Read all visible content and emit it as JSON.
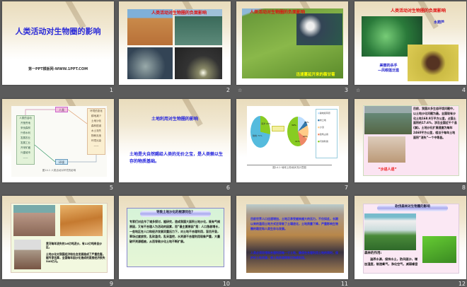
{
  "slides": [
    {
      "number": "1",
      "title": "人类活动对生物圈的影响",
      "footer": "第一PPT模板网-WWW.1PPT.COM"
    },
    {
      "number": "2",
      "title": "人类活动对生物圈的负面影响"
    },
    {
      "number": "3",
      "title": "人类活动对生物圈的负面影响",
      "caption": "迅速蔓延开来的薇甘菊",
      "anim": "☆"
    },
    {
      "number": "4",
      "title": "人类活动对生物圈的负面影响",
      "label": "水葫芦",
      "caption": "美丽的杀手\n—凤眼莲泛滥",
      "anim": "☆"
    },
    {
      "number": "5",
      "human": "人类",
      "env": "环境",
      "left": [
        "人类的活动",
        "开垦荒地",
        "采伐森林",
        "兴修水利",
        "发展农业",
        "发展工业",
        "开采矿藏",
        "兴建城市",
        "——"
      ],
      "right": [
        "环境的变化",
        "耕地减少",
        "土地沙化",
        "森林锐减",
        "水土流失",
        "物种灭绝",
        "环境污染",
        "——"
      ],
      "caption": "图14-1 人类活动对环境的影响"
    },
    {
      "number": "6",
      "title": "土地利用对生物圈的影响",
      "body": "土地是大自然赐给人类的无价之宝，是人类赖以生存的物质基础。"
    },
    {
      "number": "7",
      "legend": [
        "耕地和草原",
        "未土地",
        "沙漠",
        "建筑占用",
        "可供利用"
      ],
      "pie_left": [
        "陆地 71%",
        "海洋 29%"
      ],
      "pie_right": [
        "30%",
        "20%",
        "10%",
        "11%"
      ],
      "caption": "图14-2 地球上陆地状况示意图"
    },
    {
      "number": "8",
      "body": "目前，我国众多生态环境问题中，以土地沙化问题为最。全国现有沙化土地168.9万平方公里，占国土面积的17.6%，涉及全国近千个县(旗)。土地沙化扩展速度为每年2460平方公里，相当于每年土地面积“消失”一个中等县。",
      "caption": "“沙进人退”"
    },
    {
      "number": "9",
      "p1": "黄河每年流失的16亿吨泥沙，有12亿吨来自沙区。",
      "p2": "土地沙化对我国经济和社会发展造成了严重危害。据专家估算，全国每年因沙化造成的直接经济损失540亿元。"
    },
    {
      "number": "10",
      "title": "导致土地沙化的根源何在？",
      "body": "专家们对此作了诸多探讨，据研究，造成我国大面积土地沙化，既有气候原因，又有不合理人为活动的因素，而“最主要原因”是：人口急剧增长，一些地区在人口和经济发展双重压力下，对土地不合理利用，盲目开垦，草场过度放牧，乱砍滥伐，乱采滥挖，水资源不合理利用现象严重，大量破坏资源植被，从而导致沙化土地不断扩展。"
    },
    {
      "number": "11",
      "p1": "目前世界人口迅速增加，土地正承受越来越大的压力，不仅如此，长期以来的滥用土地方式还导致了土壤退化，土地质量下降，严重影响生物圈的稳定和人类生存与发展。",
      "p2": "人类必须珍惜和合理利用每一寸土地，确保在合理利用土地的同时，保护好土地资源，使土地资源得到可持续利用。"
    },
    {
      "number": "12",
      "title": "砍伐森林对生物圈的影响",
      "heading": "森林的作用:",
      "body": "涵养水源，保持水土，防风固沙，增加湿度，制造氧气，净化空气，减弱噪音"
    }
  ]
}
